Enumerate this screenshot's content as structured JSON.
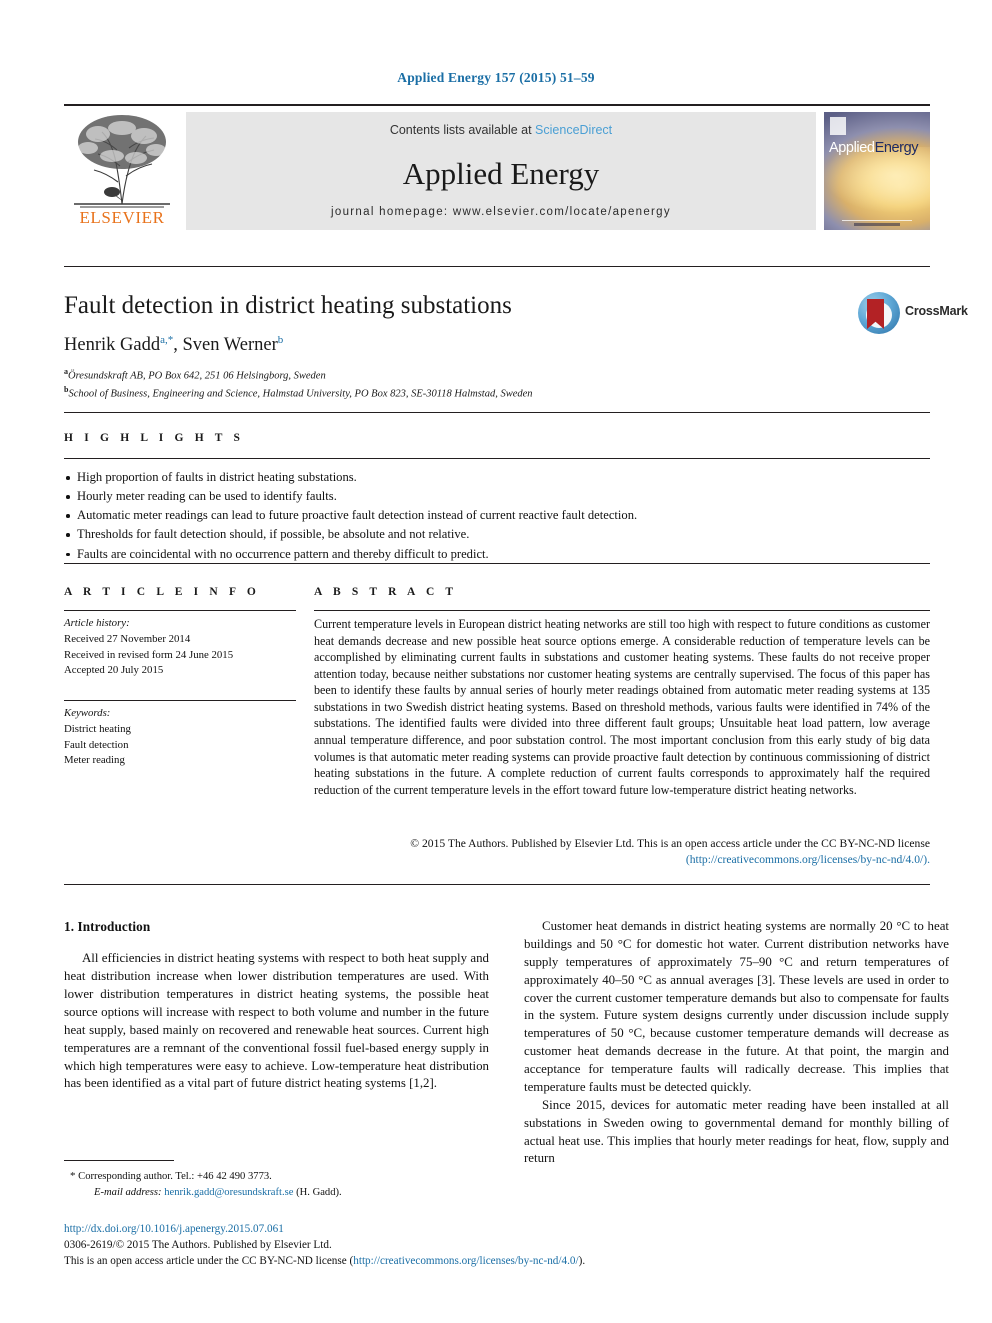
{
  "running_head": "Applied Energy 157 (2015) 51–59",
  "masthead": {
    "publisher": "ELSEVIER",
    "contents_prefix": "Contents lists available at ",
    "sciencedirect": "ScienceDirect",
    "journal_name": "Applied Energy",
    "homepage": "journal homepage: www.elsevier.com/locate/apenergy",
    "cover_title_a": "Applied",
    "cover_title_b": "Energy"
  },
  "article": {
    "title": "Fault detection in district heating substations",
    "authors": [
      {
        "name": "Henrik Gadd",
        "marks": "a,*"
      },
      {
        "name": "Sven Werner",
        "marks": "b"
      }
    ],
    "authors_line_plain": "Henrik Gadd a,*, Sven Werner b",
    "affiliations": [
      {
        "mark": "a",
        "text": "Öresundskraft AB, PO Box 642, 251 06 Helsingborg, Sweden"
      },
      {
        "mark": "b",
        "text": "School of Business, Engineering and Science, Halmstad University, PO Box 823, SE-30118 Halmstad, Sweden"
      }
    ],
    "crossmark_label": "CrossMark"
  },
  "highlights": {
    "heading": "H I G H L I G H T S",
    "items": [
      "High proportion of faults in district heating substations.",
      "Hourly meter reading can be used to identify faults.",
      "Automatic meter readings can lead to future proactive fault detection instead of current reactive fault detection.",
      "Thresholds for fault detection should, if possible, be absolute and not relative.",
      "Faults are coincidental with no occurrence pattern and thereby difficult to predict."
    ]
  },
  "article_info": {
    "heading": "A R T I C L E   I N F O",
    "history_label": "Article history:",
    "history": [
      "Received 27 November 2014",
      "Received in revised form 24 June 2015",
      "Accepted 20 July 2015"
    ],
    "keywords_label": "Keywords:",
    "keywords": [
      "District heating",
      "Fault detection",
      "Meter reading"
    ]
  },
  "abstract": {
    "heading": "A B S T R A C T",
    "text": "Current temperature levels in European district heating networks are still too high with respect to future conditions as customer heat demands decrease and new possible heat source options emerge. A considerable reduction of temperature levels can be accomplished by eliminating current faults in substations and customer heating systems. These faults do not receive proper attention today, because neither substations nor customer heating systems are centrally supervised. The focus of this paper has been to identify these faults by annual series of hourly meter readings obtained from automatic meter reading systems at 135 substations in two Swedish district heating systems. Based on threshold methods, various faults were identified in 74% of the substations. The identified faults were divided into three different fault groups; Unsuitable heat load pattern, low average annual temperature difference, and poor substation control. The most important conclusion from this early study of big data volumes is that automatic meter reading systems can provide proactive fault detection by continuous commissioning of district heating substations in the future. A complete reduction of current faults corresponds to approximately half the required reduction of the current temperature levels in the effort toward future low-temperature district heating networks.",
    "copyright_line": "© 2015 The Authors. Published by Elsevier Ltd. This is an open access article under the CC BY-NC-ND license",
    "license_url": "(http://creativecommons.org/licenses/by-nc-nd/4.0/)."
  },
  "body": {
    "section_heading": "1. Introduction",
    "left_paragraphs": [
      "All efficiencies in district heating systems with respect to both heat supply and heat distribution increase when lower distribution temperatures are used. With lower distribution temperatures in district heating systems, the possible heat source options will increase with respect to both volume and number in the future heat supply, based mainly on recovered and renewable heat sources. Current high temperatures are a remnant of the conventional fossil fuel-based energy supply in which high temperatures were easy to achieve. Low-temperature heat distribution has been identified as a vital part of future district heating systems [1,2]."
    ],
    "left_paragraph_ref": "[1,2]",
    "right_paragraphs": [
      "Customer heat demands in district heating systems are normally 20 °C to heat buildings and 50 °C for domestic hot water. Current distribution networks have supply temperatures of approximately 75–90 °C and return temperatures of approximately 40–50 °C as annual averages [3]. These levels are used in order to cover the current customer temperature demands but also to compensate for faults in the system. Future system designs currently under discussion include supply temperatures of 50 °C, because customer temperature demands will decrease as customer heat demands decrease in the future. At that point, the margin and acceptance for temperature faults will radically decrease. This implies that temperature faults must be detected quickly.",
      "Since 2015, devices for automatic meter reading have been installed at all substations in Sweden owing to governmental demand for monthly billing of actual heat use. This implies that hourly meter readings for heat, flow, supply and return"
    ],
    "right_paragraph_ref": "[3]"
  },
  "footnote": {
    "star": "*",
    "corresponding": "Corresponding author. Tel.: +46 42 490 3773.",
    "email_label": "E-mail address:",
    "email": "henrik.gadd@oresundskraft.se",
    "email_suffix": "(H. Gadd)."
  },
  "bottom": {
    "doi": "http://dx.doi.org/10.1016/j.apenergy.2015.07.061",
    "issn_line": "0306-2619/© 2015 The Authors. Published by Elsevier Ltd.",
    "license_prefix": "This is an open access article under the CC BY-NC-ND license (",
    "license_url": "http://creativecommons.org/licenses/by-nc-nd/4.0/",
    "license_suffix": ")."
  },
  "colors": {
    "link": "#1a6ea5",
    "sciencedirect": "#4a9fd4",
    "elsevier_orange": "#e8721b",
    "masthead_bg": "#e6e6e6"
  }
}
